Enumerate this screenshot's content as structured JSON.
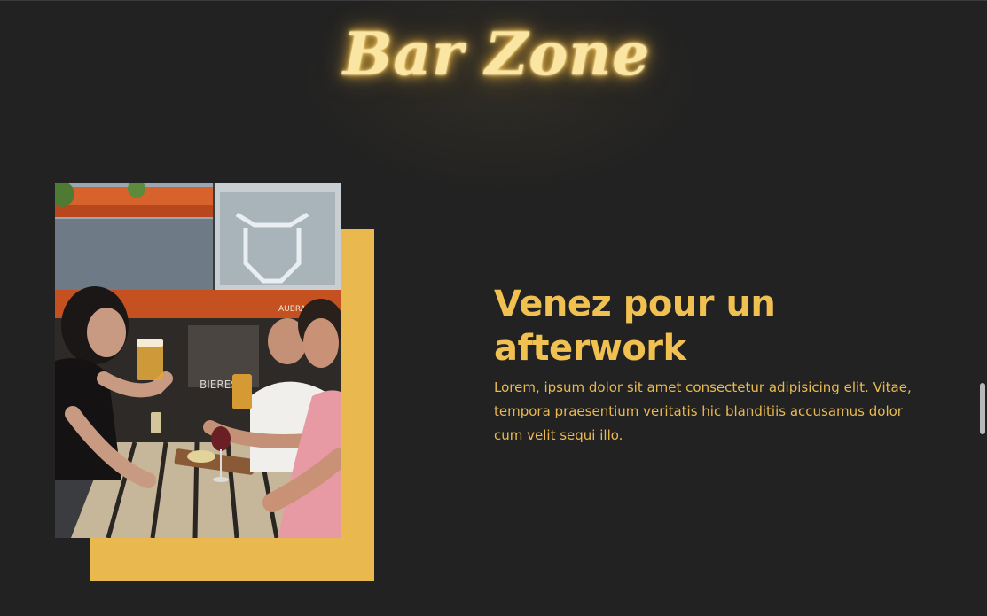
{
  "logo": {
    "text": "Bar Zone",
    "glow_color": "#f3c45a"
  },
  "section": {
    "image_alt": "Friends drinking beer at an outdoor bar terrace",
    "heading": "Venez pour un afterwork",
    "body": "Lorem, ipsum dolor sit amet consectetur adipisicing elit. Vitae, tempora praesentium veritatis hic blanditiis accusamus dolor cum velit sequi illo."
  },
  "colors": {
    "background": "#222222",
    "accent": "#e9b94f",
    "heading": "#f0c050"
  }
}
